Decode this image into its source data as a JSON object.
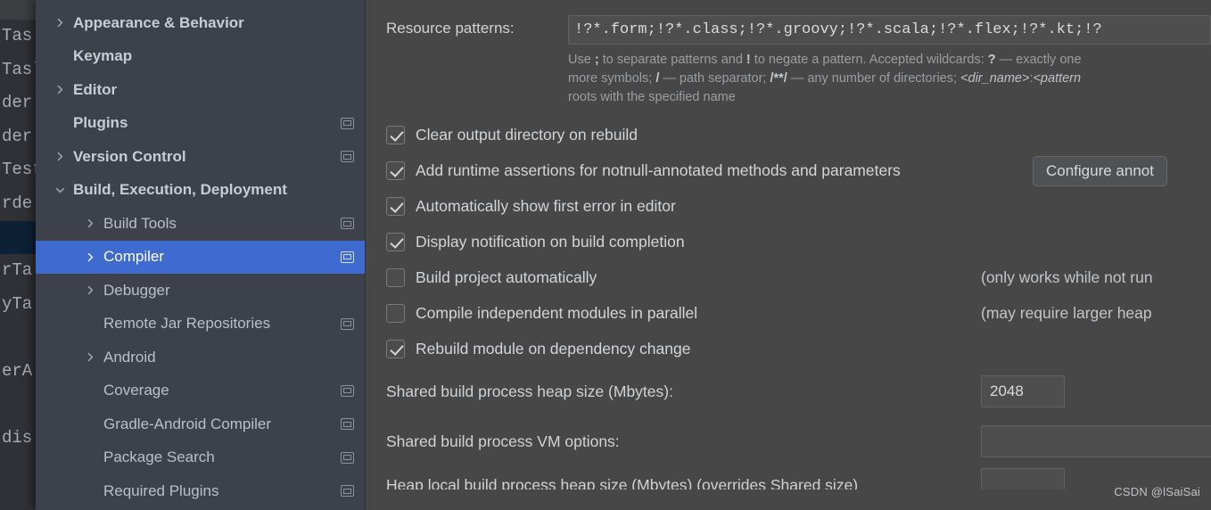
{
  "background_editor": {
    "lines": [
      "Tas",
      "Tasl",
      "der",
      "der",
      "Test",
      "rde",
      "",
      "rTa",
      "yTa",
      "",
      "erA",
      "",
      "dis"
    ]
  },
  "settings_tree": {
    "items": [
      {
        "label": "Appearance & Behavior",
        "arrow": "right",
        "level": 0,
        "bold": true,
        "marker": false,
        "selected": false
      },
      {
        "label": "Keymap",
        "arrow": "none",
        "level": 0,
        "bold": true,
        "marker": false,
        "selected": false
      },
      {
        "label": "Editor",
        "arrow": "right",
        "level": 0,
        "bold": true,
        "marker": false,
        "selected": false
      },
      {
        "label": "Plugins",
        "arrow": "none",
        "level": 0,
        "bold": true,
        "marker": true,
        "selected": false
      },
      {
        "label": "Version Control",
        "arrow": "right",
        "level": 0,
        "bold": true,
        "marker": true,
        "selected": false
      },
      {
        "label": "Build, Execution, Deployment",
        "arrow": "down",
        "level": 0,
        "bold": true,
        "marker": false,
        "selected": false
      },
      {
        "label": "Build Tools",
        "arrow": "right",
        "level": 1,
        "bold": false,
        "marker": true,
        "selected": false
      },
      {
        "label": "Compiler",
        "arrow": "right",
        "level": 1,
        "bold": false,
        "marker": true,
        "selected": true
      },
      {
        "label": "Debugger",
        "arrow": "right",
        "level": 1,
        "bold": false,
        "marker": false,
        "selected": false
      },
      {
        "label": "Remote Jar Repositories",
        "arrow": "none",
        "level": 1,
        "bold": false,
        "marker": true,
        "selected": false
      },
      {
        "label": "Android",
        "arrow": "right",
        "level": 1,
        "bold": false,
        "marker": false,
        "selected": false
      },
      {
        "label": "Coverage",
        "arrow": "none",
        "level": 1,
        "bold": false,
        "marker": true,
        "selected": false
      },
      {
        "label": "Gradle-Android Compiler",
        "arrow": "none",
        "level": 1,
        "bold": false,
        "marker": true,
        "selected": false
      },
      {
        "label": "Package Search",
        "arrow": "none",
        "level": 1,
        "bold": false,
        "marker": true,
        "selected": false
      },
      {
        "label": "Required Plugins",
        "arrow": "none",
        "level": 1,
        "bold": false,
        "marker": true,
        "selected": false
      }
    ],
    "selection_color": "#3f6ad0",
    "background_color": "#3c414b"
  },
  "compiler_panel": {
    "resource_patterns": {
      "label": "Resource patterns:",
      "value": "!?*.form;!?*.class;!?*.groovy;!?*.scala;!?*.flex;!?*.kt;!?",
      "placeholder": "Resource patterns"
    },
    "help_lines": [
      "Use ; to separate patterns and ! to negate a pattern. Accepted wildcards: ? — exactly one",
      "more symbols; / — path separator; /**/ — any number of directories; <dir_name>:<pattern",
      "roots with the specified name"
    ],
    "checkboxes": [
      {
        "label": "Clear output directory on rebuild",
        "checked": true,
        "note": ""
      },
      {
        "label": "Add runtime assertions for notnull-annotated methods and parameters",
        "checked": true,
        "note": ""
      },
      {
        "label": "Automatically show first error in editor",
        "checked": true,
        "note": ""
      },
      {
        "label": "Display notification on build completion",
        "checked": true,
        "note": ""
      },
      {
        "label": "Build project automatically",
        "checked": false,
        "note": "(only works while not run"
      },
      {
        "label": "Compile independent modules in parallel",
        "checked": false,
        "note": "(may require larger heap"
      },
      {
        "label": "Rebuild module on dependency change",
        "checked": true,
        "note": ""
      }
    ],
    "configure_annotations_button": "Configure annot",
    "fields": [
      {
        "label": "Shared build process heap size (Mbytes):",
        "value": "2048",
        "size": "narrow"
      },
      {
        "label": "Shared build process VM options:",
        "value": "",
        "size": "wide"
      },
      {
        "label": "Heap local build process heap size (Mbytes) (overrides Shared size)",
        "value": "",
        "size": "narrow"
      }
    ]
  },
  "watermark": "CSDN @lSaiSai"
}
